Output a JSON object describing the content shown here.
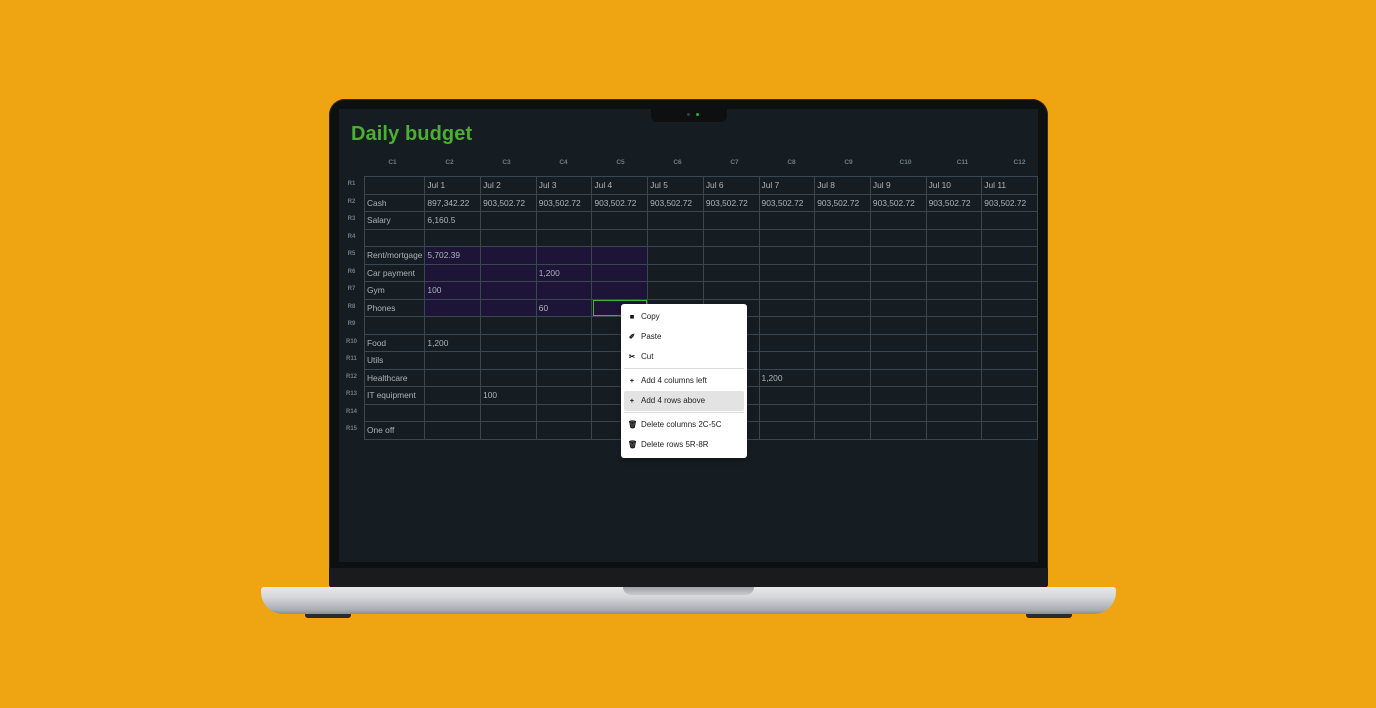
{
  "app": {
    "title": "Daily budget"
  },
  "columns": [
    "C1",
    "C2",
    "C3",
    "C4",
    "C5",
    "C6",
    "C7",
    "C8",
    "C9",
    "C10",
    "C11",
    "C12"
  ],
  "row_headers": [
    "R1",
    "R2",
    "R3",
    "R4",
    "R5",
    "R6",
    "R7",
    "R8",
    "R9",
    "R10",
    "R11",
    "R12",
    "R13",
    "R14",
    "R15"
  ],
  "rows": [
    [
      "",
      "Jul 1",
      "Jul 2",
      "Jul 3",
      "Jul 4",
      "Jul 5",
      "Jul 6",
      "Jul 7",
      "Jul 8",
      "Jul 9",
      "Jul 10",
      "Jul 11"
    ],
    [
      "Cash",
      "897,342.22",
      "903,502.72",
      "903,502.72",
      "903,502.72",
      "903,502.72",
      "903,502.72",
      "903,502.72",
      "903,502.72",
      "903,502.72",
      "903,502.72",
      "903,502.72"
    ],
    [
      "Salary",
      "6,160.5",
      "",
      "",
      "",
      "",
      "",
      "",
      "",
      "",
      "",
      ""
    ],
    [
      "",
      "",
      "",
      "",
      "",
      "",
      "",
      "",
      "",
      "",
      "",
      ""
    ],
    [
      "Rent/mortgage",
      "5,702.39",
      "",
      "",
      "",
      "",
      "",
      "",
      "",
      "",
      "",
      ""
    ],
    [
      "Car payment",
      "",
      "",
      "1,200",
      "",
      "",
      "",
      "",
      "",
      "",
      "",
      ""
    ],
    [
      "Gym",
      "100",
      "",
      "",
      "",
      "",
      "",
      "",
      "",
      "",
      "",
      ""
    ],
    [
      "Phones",
      "",
      "",
      "60",
      "",
      "",
      "",
      "",
      "",
      "",
      "",
      ""
    ],
    [
      "",
      "",
      "",
      "",
      "",
      "",
      "",
      "",
      "",
      "",
      "",
      ""
    ],
    [
      "Food",
      "1,200",
      "",
      "",
      "",
      "",
      "",
      "",
      "",
      "",
      "",
      ""
    ],
    [
      "Utils",
      "",
      "",
      "",
      "",
      "",
      "",
      "",
      "",
      "",
      "",
      ""
    ],
    [
      "Healthcare",
      "",
      "",
      "",
      "",
      "",
      "",
      "1,200",
      "",
      "",
      "",
      ""
    ],
    [
      "IT equipment",
      "",
      "100",
      "",
      "",
      "",
      "",
      "",
      "",
      "",
      "",
      ""
    ],
    [
      "",
      "",
      "",
      "",
      "",
      "",
      "",
      "",
      "",
      "",
      "",
      ""
    ],
    [
      "One off",
      "",
      "",
      "",
      "",
      "",
      "",
      "",
      "",
      "",
      "",
      ""
    ]
  ],
  "selection": {
    "rows": [
      5,
      8
    ],
    "cols": [
      2,
      5
    ],
    "active_cell": "R8C5"
  },
  "context_menu": {
    "items": [
      {
        "icon": "copy-icon",
        "glyph": "■",
        "label": "Copy"
      },
      {
        "icon": "paste-icon",
        "glyph": "✐",
        "label": "Paste"
      },
      {
        "icon": "cut-icon",
        "glyph": "✂",
        "label": "Cut"
      },
      {
        "separator": true
      },
      {
        "icon": "plus-icon",
        "glyph": "+",
        "label": "Add 4 columns left"
      },
      {
        "icon": "plus-icon",
        "glyph": "+",
        "label": "Add 4 rows above",
        "highlighted": true
      },
      {
        "separator": true
      },
      {
        "icon": "trash-icon",
        "glyph": "🗑",
        "label": "Delete columns 2C-5C"
      },
      {
        "icon": "trash-icon",
        "glyph": "🗑",
        "label": "Delete rows 5R-8R"
      }
    ]
  },
  "colors": {
    "background": "#EFA412",
    "screen": "#161d22",
    "accent_title": "#4cae33",
    "selection_fill": "#1e1437",
    "active_cell_border": "#45b233"
  }
}
